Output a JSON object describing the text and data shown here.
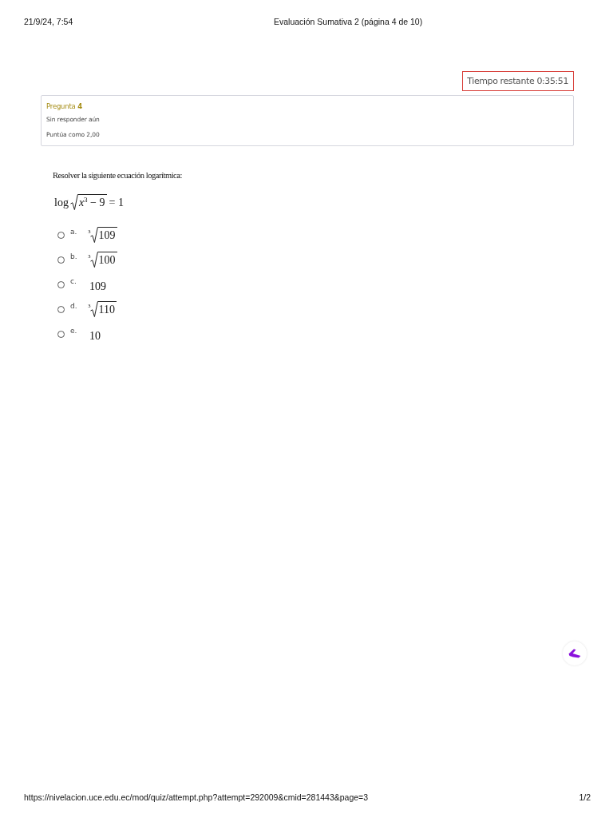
{
  "page_header": {
    "datetime": "21/9/24, 7:54",
    "title": "Evaluación Sumativa 2 (página 4 de 10)"
  },
  "timer": {
    "label": "Tiempo restante 0:35:51"
  },
  "question_info": {
    "heading": "Pregunta **4**",
    "status": "Sin responder aún",
    "grade": "Puntúa como 2,00"
  },
  "question": {
    "prompt": "Resolver la siguiente ecuación logarítmica:",
    "equation": {
      "function": "log",
      "radicand": "*x*$^{3}$ − 9",
      "rhs": "= 1"
    },
    "options": [
      {
        "letter": "a.",
        "kind": "root",
        "index": "3",
        "radicand": "109",
        "selected": false
      },
      {
        "letter": "b.",
        "kind": "root",
        "index": "3",
        "radicand": "100",
        "selected": false
      },
      {
        "letter": "c.",
        "kind": "number",
        "value": "109",
        "selected": false
      },
      {
        "letter": "d.",
        "kind": "root",
        "index": "3",
        "radicand": "110",
        "selected": false
      },
      {
        "letter": "e.",
        "kind": "number",
        "value": "10",
        "selected": false
      }
    ]
  },
  "page_footer": {
    "url": "https://nivelacion.uce.edu.ec/mod/quiz/attempt.php?attempt=292009&cmid=281443&page=3",
    "page_count": "1/2"
  }
}
